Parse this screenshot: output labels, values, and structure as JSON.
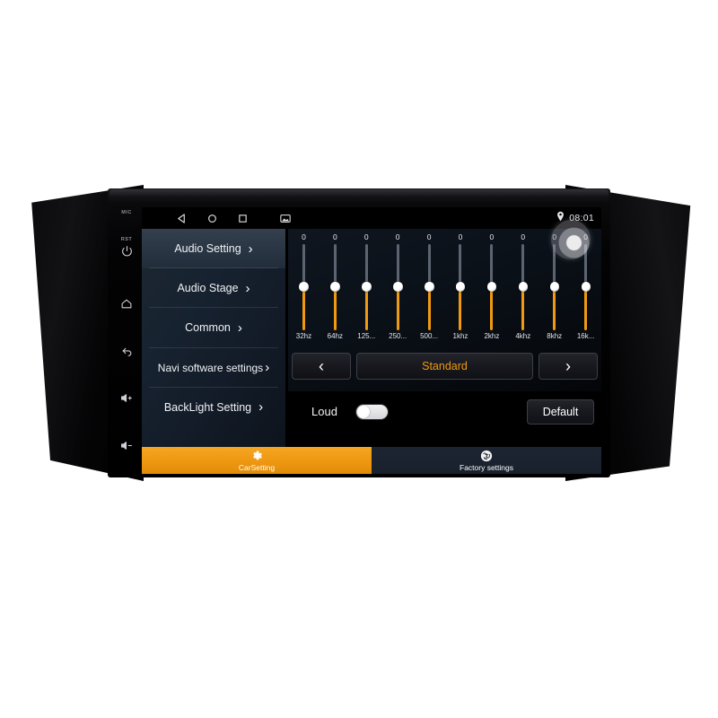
{
  "device": {
    "hardware_buttons": [
      {
        "name": "mic",
        "label": "MIC",
        "type": "text"
      },
      {
        "name": "rst",
        "label": "RST",
        "type": "text"
      },
      {
        "name": "power",
        "label": "",
        "type": "icon",
        "icon": "power-icon"
      },
      {
        "name": "home",
        "label": "",
        "type": "icon",
        "icon": "home-icon"
      },
      {
        "name": "back",
        "label": "",
        "type": "icon",
        "icon": "back-arrow-icon"
      },
      {
        "name": "volume-up",
        "label": "",
        "type": "icon",
        "icon": "volume-up-icon"
      },
      {
        "name": "volume-down",
        "label": "",
        "type": "icon",
        "icon": "volume-down-icon"
      }
    ]
  },
  "statusbar": {
    "nav_back": "back-triangle-icon",
    "nav_home": "home-circle-icon",
    "nav_recents": "recents-square-icon",
    "nav_gallery": "gallery-icon",
    "location_icon": "location-pin-icon",
    "time": "08:01"
  },
  "menu": {
    "items": [
      {
        "label": "Audio Setting",
        "active": true,
        "chevron": "›"
      },
      {
        "label": "Audio Stage",
        "active": false,
        "chevron": "›"
      },
      {
        "label": "Common",
        "active": false,
        "chevron": "›"
      },
      {
        "label": "Navi software settings",
        "active": false,
        "chevron": "›"
      },
      {
        "label": "BackLight Setting",
        "active": false,
        "chevron": "›"
      }
    ]
  },
  "equalizer": {
    "bands": [
      {
        "freq": "32hz",
        "value": "0"
      },
      {
        "freq": "64hz",
        "value": "0"
      },
      {
        "freq": "125...",
        "value": "0"
      },
      {
        "freq": "250...",
        "value": "0"
      },
      {
        "freq": "500...",
        "value": "0"
      },
      {
        "freq": "1khz",
        "value": "0"
      },
      {
        "freq": "2khz",
        "value": "0"
      },
      {
        "freq": "4khz",
        "value": "0"
      },
      {
        "freq": "8khz",
        "value": "0"
      },
      {
        "freq": "16k...",
        "value": "0"
      }
    ],
    "preset_prev": "‹",
    "preset_name": "Standard",
    "preset_next": "›",
    "loud_label": "Loud",
    "loud_on": false,
    "default_label": "Default",
    "accent_color": "#ef9a10",
    "track_color": "#5b6470"
  },
  "tabs": [
    {
      "label": "CarSetting",
      "icon": "gear-icon",
      "active": true
    },
    {
      "label": "Factory settings",
      "icon": "factory-logo-icon",
      "active": false
    }
  ]
}
